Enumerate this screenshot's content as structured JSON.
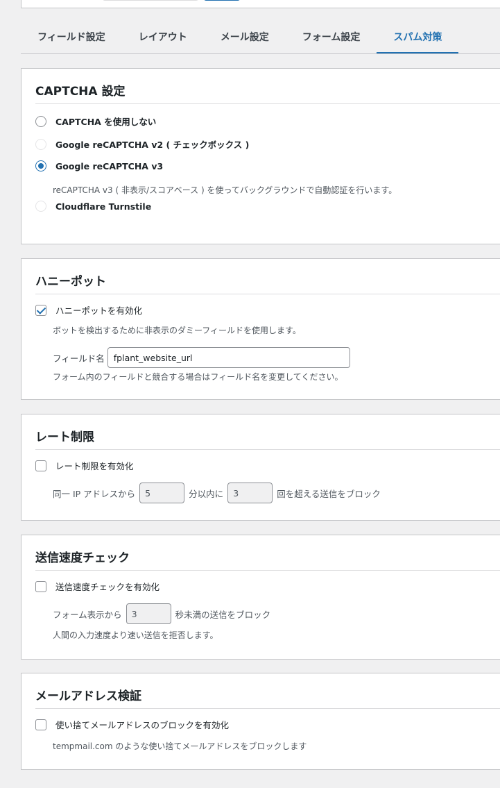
{
  "tabs": [
    "フィールド設定",
    "レイアウト",
    "メール設定",
    "フォーム設定",
    "スパム対策"
  ],
  "active_tab": "スパム対策",
  "captcha": {
    "title": "CAPTCHA 設定",
    "options": [
      "CAPTCHA を使用しない",
      "Google reCAPTCHA v2 ( チェックボックス )",
      "Google reCAPTCHA v3",
      "Cloudflare Turnstile"
    ],
    "selected": "Google reCAPTCHA v3",
    "v3_desc": "reCAPTCHA v3 ( 非表示/スコアベース ) を使ってバックグラウンドで自動認証を行います。"
  },
  "honeypot": {
    "title": "ハニーポット",
    "enable_label": "ハニーポットを有効化",
    "enabled": true,
    "desc": "ボットを検出するために非表示のダミーフィールドを使用します。",
    "field_name_label": "フィールド名",
    "field_name_value": "fplant_website_url",
    "field_desc": "フォーム内のフィールドと競合する場合はフィールド名を変更してください。"
  },
  "rate_limit": {
    "title": "レート制限",
    "enable_label": "レート制限を有効化",
    "enabled": false,
    "prefix": "同一 IP アドレスから",
    "minutes": "5",
    "middle": "分以内に",
    "count": "3",
    "suffix": "回を超える送信をブロック"
  },
  "speed_check": {
    "title": "送信速度チェック",
    "enable_label": "送信速度チェックを有効化",
    "enabled": false,
    "prefix": "フォーム表示から",
    "seconds": "3",
    "suffix": "秒未満の送信をブロック",
    "desc": "人間の入力速度より速い送信を拒否します。"
  },
  "email_validation": {
    "title": "メールアドレス検証",
    "enable_label": "使い捨てメールアドレスのブロックを有効化",
    "enabled": false,
    "desc": "tempmail.com のような使い捨てメールアドレスをブロックします"
  },
  "colors": {
    "accent": "#2271b1",
    "background": "#f0f0f1",
    "card": "#ffffff",
    "border": "#c3c4c7"
  }
}
